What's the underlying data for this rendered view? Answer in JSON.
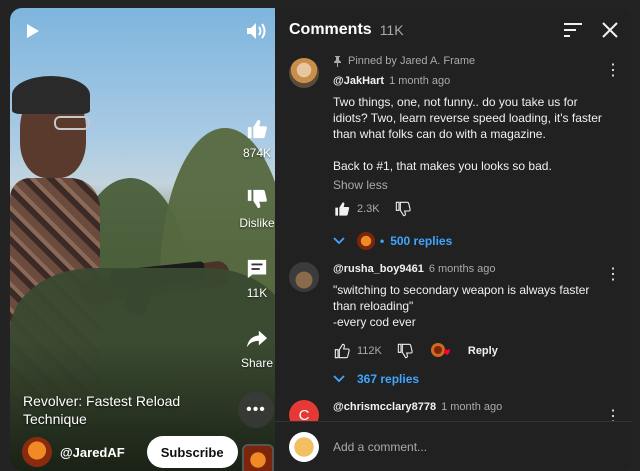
{
  "player": {
    "video_title": "Revolver: Fastest Reload Technique",
    "channel_name": "@JaredAF",
    "subscribe_label": "Subscribe",
    "like_count": "874K",
    "dislike_label": "Dislike",
    "comment_count": "11K",
    "share_label": "Share"
  },
  "comments_panel": {
    "title": "Comments",
    "count": "11K",
    "composer_placeholder": "Add a comment...",
    "comments": [
      {
        "pinned_by": "Pinned by Jared A. Frame",
        "author": "@JakHart",
        "time": "1 month ago",
        "text": "Two things, one, not funny.. do you take us for idiots? Two, learn reverse speed loading, it's faster than what folks can do with a magazine.\n\nBack to #1, that makes you looks so bad.",
        "show_less": "Show less",
        "likes": "2.3K",
        "replies": "500 replies"
      },
      {
        "author": "@rusha_boy9461",
        "time": "6 months ago",
        "text": "\"switching to secondary weapon is always faster than reloading\"\n-every cod ever",
        "likes": "112K",
        "reply_label": "Reply",
        "replies": "367 replies"
      },
      {
        "author": "@chrismcclary8778",
        "time": "1 month ago",
        "avatar_letter": "C"
      }
    ]
  },
  "colors": {
    "accent_link": "#3ea6ff",
    "avatar_c": "#e53935"
  }
}
